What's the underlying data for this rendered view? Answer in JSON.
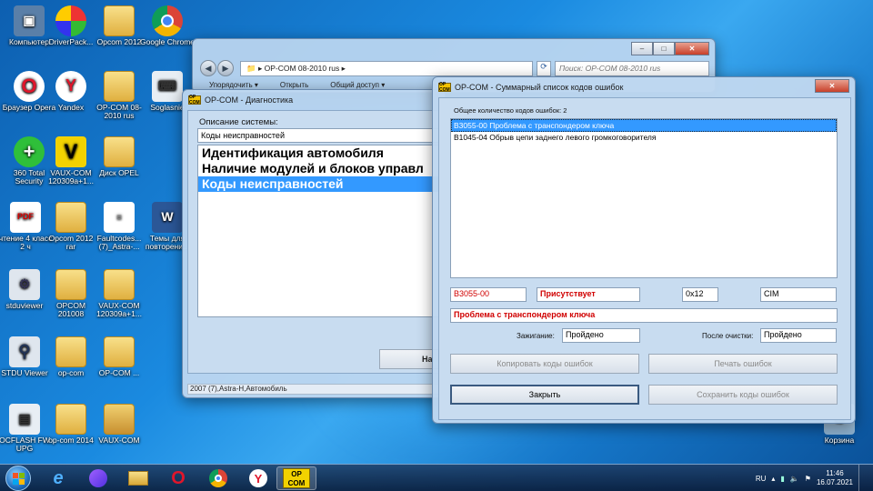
{
  "desktop_icons": [
    {
      "label": "Компьютер"
    },
    {
      "label": "DriverPack..."
    },
    {
      "label": "Opcom 2012"
    },
    {
      "label": "Google Chrome"
    },
    {
      "label": "Браузер Opera"
    },
    {
      "label": "Yandex"
    },
    {
      "label": "OP-COM 08-2010 rus"
    },
    {
      "label": "Soglasnie"
    },
    {
      "label": "360 Total Security"
    },
    {
      "label": "VAUX-COM 120309a+1..."
    },
    {
      "label": "Диск OPEL"
    },
    {
      "label": "чтение 4 класс 2 ч"
    },
    {
      "label": "Opcom 2012 rar"
    },
    {
      "label": "Faultcodes... (7)_Astra-..."
    },
    {
      "label": "Темы для повторени..."
    },
    {
      "label": "stduviewer"
    },
    {
      "label": "OPCOM 201008"
    },
    {
      "label": "VAUX-COM 120309a+1..."
    },
    {
      "label": "STDU Viewer"
    },
    {
      "label": "op-com"
    },
    {
      "label": "OP-COM ..."
    },
    {
      "label": "OCFLASH FW UPG"
    },
    {
      "label": "op-com 2014"
    },
    {
      "label": "VAUX-COM"
    },
    {
      "label": "Корзина"
    }
  ],
  "explorer": {
    "path": "OP-COM 08-2010 rus",
    "search_placeholder": "Поиск: OP-COM 08-2010 rus",
    "toolbar": [
      "Упорядочить ▾",
      "Открыть",
      "Общий доступ ▾"
    ]
  },
  "diag_window": {
    "title": "OP-COM - Диагностика",
    "app_icon": "OP COM",
    "system_desc_label": "Описание системы:",
    "system_desc_value": "Коды неисправностей",
    "menu_items": [
      "Идентификация автомобиля",
      "Наличие модулей и блоков управл",
      "Коды неисправностей"
    ],
    "selected_index": 2,
    "button_partial": "На",
    "status": "2007 (7),Astra-H,Автомобиль"
  },
  "codes_window": {
    "title": "OP-COM - Суммарный список кодов ошибок",
    "count_label": "Общее количество кодов ошибок: 2",
    "codes": [
      "B3055-00 Проблема с транспондером ключа",
      "B1045-04 Обрыв цепи заднего левого громкоговорителя"
    ],
    "selected_index": 0,
    "detail_code": "B3055-00",
    "detail_status": "Присутствует",
    "detail_hex": "0x12",
    "detail_module": "CIM",
    "detail_desc": "Проблема с транспондером ключа",
    "ignition_label": "Зажигание:",
    "ignition_value": "Пройдено",
    "after_clear_label": "После очистки:",
    "after_clear_value": "Пройдено",
    "btn_copy": "Копировать коды ошибок",
    "btn_print": "Печать ошибок",
    "btn_close": "Закрыть",
    "btn_save": "Сохранить коды ошибок"
  },
  "taskbar": {
    "lang": "RU",
    "time": "11:46",
    "date": "16.07.2021",
    "opcom_label": "OP COM"
  }
}
